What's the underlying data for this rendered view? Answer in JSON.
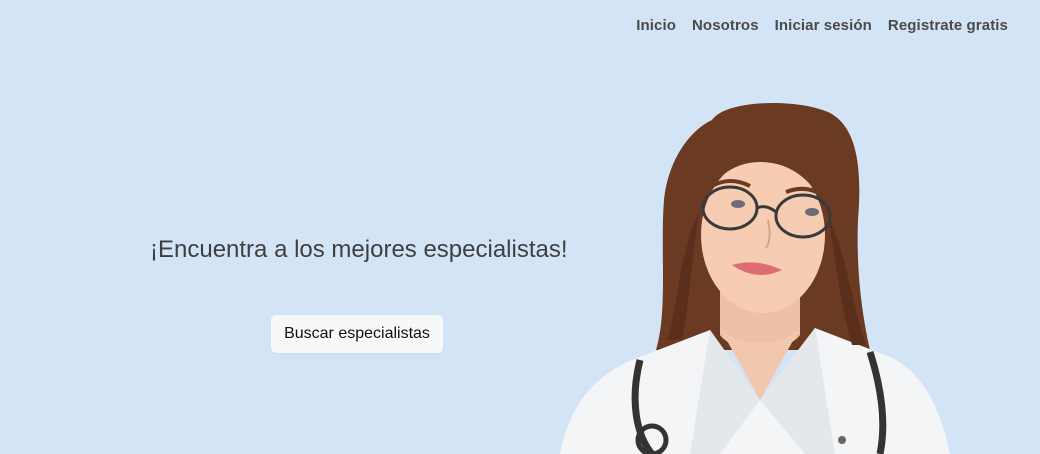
{
  "nav": {
    "items": [
      "Inicio",
      "Nosotros",
      "Iniciar sesión",
      "Registrate gratis"
    ]
  },
  "hero": {
    "title": "¡Encuentra a los mejores especialistas!",
    "cta_label": "Buscar especialistas"
  },
  "image": {
    "subject": "doctor-portrait"
  },
  "colors": {
    "background": "#d3e4f6",
    "nav_text": "#4a4a4a",
    "title_text": "#3f3f3f",
    "button_bg": "#f7f8fa"
  }
}
